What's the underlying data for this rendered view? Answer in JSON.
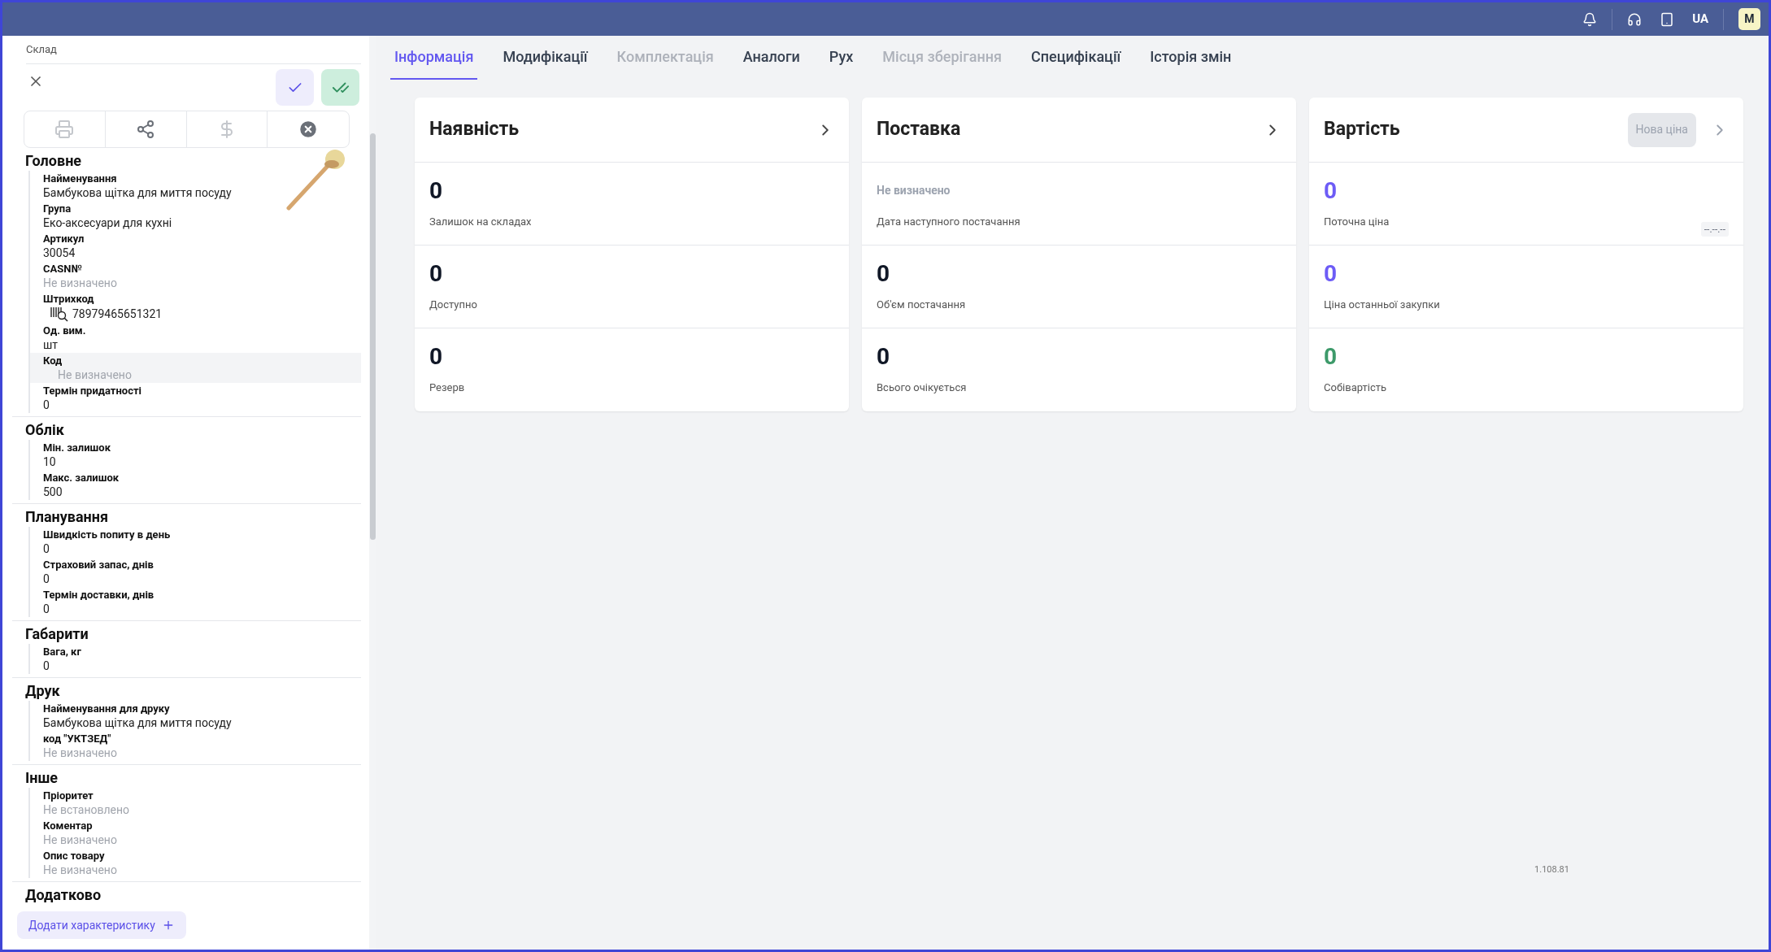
{
  "top_bar": {
    "language": "UA",
    "user_initial": "M"
  },
  "sidebar": {
    "breadcrumb": "Склад",
    "sections": [
      {
        "title": "Головне",
        "fields": [
          {
            "label": "Найменування",
            "value": "Бамбукова щітка для миття посуду",
            "kind": "text",
            "highlighted": false
          },
          {
            "label": "Група",
            "value": "Еко-аксесуари для кухні",
            "kind": "text",
            "highlighted": false
          },
          {
            "label": "Артикул",
            "value": "30054",
            "kind": "text",
            "highlighted": false
          },
          {
            "label": "CASN№",
            "placeholder": "Не визначено",
            "kind": "text",
            "highlighted": false
          },
          {
            "label": "Штрихкод",
            "value": "78979465651321",
            "kind": "barcode",
            "highlighted": false
          },
          {
            "label": "Од. вим.",
            "value": "шт",
            "kind": "text",
            "highlighted": false
          },
          {
            "label": "Код",
            "placeholder": "Не визначено",
            "kind": "text",
            "highlighted": true
          },
          {
            "label": "Термін придатності",
            "value": "0",
            "kind": "text",
            "highlighted": false
          }
        ]
      },
      {
        "title": "Облік",
        "fields": [
          {
            "label": "Мін. залишок",
            "value": "10",
            "kind": "text",
            "highlighted": false
          },
          {
            "label": "Макс. залишок",
            "value": "500",
            "kind": "text",
            "highlighted": false
          }
        ]
      },
      {
        "title": "Планування",
        "fields": [
          {
            "label": "Швидкість попиту в день",
            "value": "0",
            "kind": "text",
            "highlighted": false
          },
          {
            "label": "Страховий запас, днів",
            "value": "0",
            "kind": "text",
            "highlighted": false
          },
          {
            "label": "Термін доставки, днів",
            "value": "0",
            "kind": "text",
            "highlighted": false
          }
        ]
      },
      {
        "title": "Габарити",
        "fields": [
          {
            "label": "Вага, кг",
            "value": "0",
            "kind": "text",
            "highlighted": false
          }
        ]
      },
      {
        "title": "Друк",
        "fields": [
          {
            "label": "Найменування для друку",
            "value": "Бамбукова щітка для миття посуду",
            "kind": "text",
            "highlighted": false
          },
          {
            "label": "код \"УКТЗЕД\"",
            "placeholder": "Не визначено",
            "kind": "text",
            "highlighted": false
          }
        ]
      },
      {
        "title": "Інше",
        "fields": [
          {
            "label": "Пріоритет",
            "placeholder": "Не встановлено",
            "kind": "text",
            "highlighted": false
          },
          {
            "label": "Коментар",
            "placeholder": "Не визначено",
            "kind": "text",
            "highlighted": false
          },
          {
            "label": "Опис товару",
            "placeholder": "Не визначено",
            "kind": "text",
            "highlighted": false
          }
        ]
      },
      {
        "title": "Додатково"
      }
    ],
    "add_button": "Додати характеристику"
  },
  "tabs": [
    {
      "label": "Інформація",
      "selected": true,
      "disabled": false
    },
    {
      "label": "Модифікації",
      "selected": false,
      "disabled": false
    },
    {
      "label": "Комплектація",
      "selected": false,
      "disabled": true
    },
    {
      "label": "Аналоги",
      "selected": false,
      "disabled": false
    },
    {
      "label": "Рух",
      "selected": false,
      "disabled": false
    },
    {
      "label": "Місця зберігання",
      "selected": false,
      "disabled": true
    },
    {
      "label": "Специфікації",
      "selected": false,
      "disabled": false
    },
    {
      "label": "Історія змін",
      "selected": false,
      "disabled": false
    }
  ],
  "cards": [
    {
      "title": "Наявність",
      "rows": [
        {
          "value": "0",
          "label": "Залишок на складах",
          "kind": "number",
          "color": "#111827"
        },
        {
          "value": "0",
          "label": "Доступно",
          "kind": "number",
          "color": "#111827"
        },
        {
          "value": "0",
          "label": "Резерв",
          "kind": "number",
          "color": "#111827"
        }
      ]
    },
    {
      "title": "Поставка",
      "rows": [
        {
          "value": "Не визначено",
          "label": "Дата наступного постачання",
          "kind": "empty",
          "color": "#9ca3af"
        },
        {
          "value": "0",
          "label": "Об'єм постачання",
          "kind": "number",
          "color": "#111827"
        },
        {
          "value": "0",
          "label": "Всього очікується",
          "kind": "number",
          "color": "#111827"
        }
      ]
    },
    {
      "title": "Вартість",
      "button": "Нова ціна",
      "rows": [
        {
          "value": "0",
          "label": "Поточна ціна",
          "kind": "number",
          "color": "#6d5cf6",
          "date": "--.--.--"
        },
        {
          "value": "0",
          "label": "Ціна останньої закупки",
          "kind": "number",
          "color": "#6d5cf6"
        },
        {
          "value": "0",
          "label": "Собівартість",
          "kind": "number",
          "color": "#3d9a6a"
        }
      ]
    }
  ],
  "version": "1.108.81"
}
